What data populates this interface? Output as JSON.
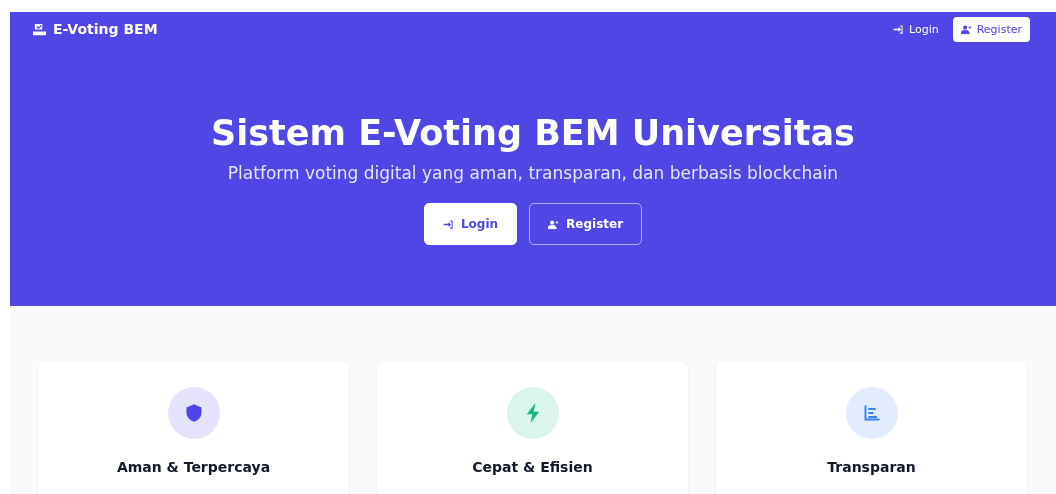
{
  "navbar": {
    "brand": "E-Voting BEM",
    "links": [
      {
        "label": "Login",
        "kind": "link"
      },
      {
        "label": "Register",
        "kind": "button"
      }
    ]
  },
  "hero": {
    "title": "Sistem E-Voting BEM Universitas",
    "subtitle": "Platform voting digital yang aman, transparan, dan berbasis blockchain",
    "buttons": [
      {
        "label": "Login",
        "kind": "solid"
      },
      {
        "label": "Register",
        "kind": "outline"
      }
    ]
  },
  "features": [
    {
      "title": "Aman & Terpercaya",
      "kind": "shield",
      "color": "#4f46e5"
    },
    {
      "title": "Cepat & Efisien",
      "kind": "bolt",
      "color": "#10b981"
    },
    {
      "title": "Transparan",
      "kind": "chart",
      "color": "#3b82f6"
    }
  ]
}
